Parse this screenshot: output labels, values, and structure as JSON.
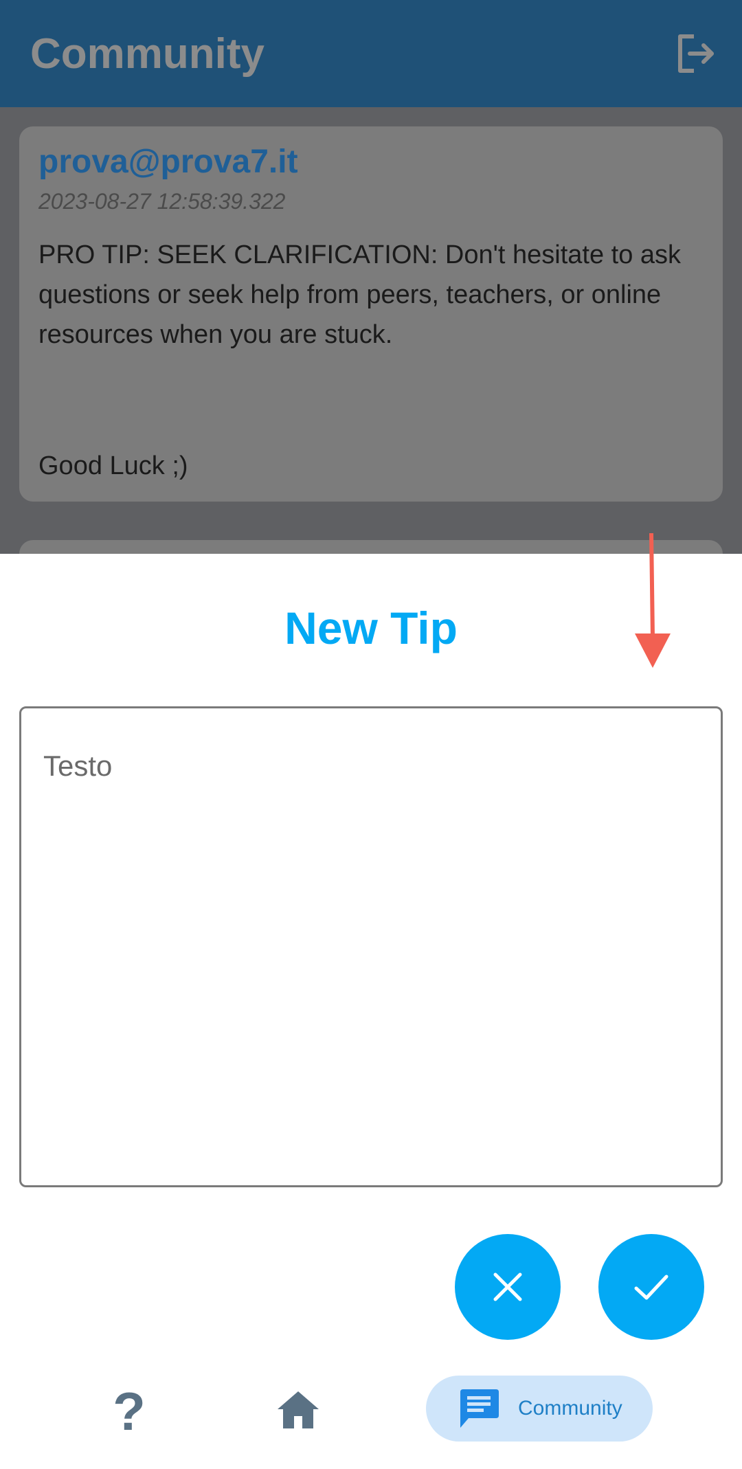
{
  "appbar": {
    "title": "Community"
  },
  "post": {
    "author": "prova@prova7.it",
    "date": "2023-08-27 12:58:39.322",
    "body": "PRO TIP: SEEK CLARIFICATION: Don't hesitate to ask questions or seek help from peers, teachers, or online resources when you are stuck.",
    "sign": "Good Luck ;)"
  },
  "sheet": {
    "title": "New Tip",
    "text_label": "Testo"
  },
  "bottom_nav": {
    "help_label": "?",
    "community_label": "Community"
  },
  "colors": {
    "accent": "#03a9f4",
    "appbar": "#1f5177",
    "annotation_arrow": "#f26052"
  }
}
